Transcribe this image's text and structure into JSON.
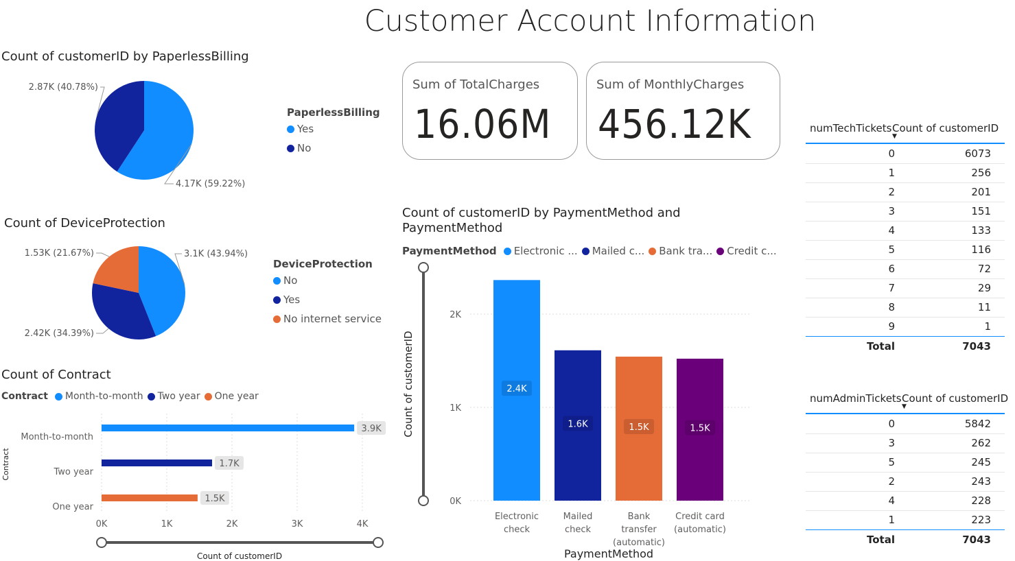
{
  "page": {
    "title": "Customer Account Information"
  },
  "colors": {
    "light_blue": "#118DFF",
    "dark_blue": "#12239E",
    "orange": "#E66C37",
    "purple": "#6B007B"
  },
  "cards": [
    {
      "label": "Sum of TotalCharges",
      "value": "16.06M"
    },
    {
      "label": "Sum of MonthlyCharges",
      "value": "456.12K"
    }
  ],
  "tables": {
    "tech": {
      "headers": [
        "numTechTickets",
        "Count of customerID"
      ],
      "rows": [
        [
          "0",
          "6073"
        ],
        [
          "1",
          "256"
        ],
        [
          "2",
          "201"
        ],
        [
          "3",
          "151"
        ],
        [
          "4",
          "133"
        ],
        [
          "5",
          "116"
        ],
        [
          "6",
          "72"
        ],
        [
          "7",
          "29"
        ],
        [
          "8",
          "11"
        ],
        [
          "9",
          "1"
        ]
      ],
      "total_label": "Total",
      "total_value": "7043"
    },
    "admin": {
      "headers": [
        "numAdminTickets",
        "Count of customerID"
      ],
      "rows": [
        [
          "0",
          "5842"
        ],
        [
          "3",
          "262"
        ],
        [
          "5",
          "245"
        ],
        [
          "2",
          "243"
        ],
        [
          "4",
          "228"
        ],
        [
          "1",
          "223"
        ]
      ],
      "total_label": "Total",
      "total_value": "7043"
    }
  },
  "chart_data": [
    {
      "type": "pie",
      "title": "Count of customerID by PaperlessBilling",
      "legend_title": "PaperlessBilling",
      "legend_position": "right",
      "slices": [
        {
          "label": "Yes",
          "value": 4170,
          "display": "4.17K (59.22%)",
          "color": "#118DFF"
        },
        {
          "label": "No",
          "value": 2870,
          "display": "2.87K (40.78%)",
          "color": "#12239E"
        }
      ]
    },
    {
      "type": "pie",
      "title": "Count of DeviceProtection",
      "legend_title": "DeviceProtection",
      "legend_position": "right",
      "slices": [
        {
          "label": "No",
          "value": 3100,
          "display": "3.1K (43.94%)",
          "color": "#118DFF"
        },
        {
          "label": "Yes",
          "value": 2420,
          "display": "2.42K (34.39%)",
          "color": "#12239E"
        },
        {
          "label": "No internet service",
          "value": 1530,
          "display": "1.53K (21.67%)",
          "color": "#E66C37"
        }
      ]
    },
    {
      "type": "bar",
      "orientation": "horizontal",
      "title": "Count of Contract",
      "legend_title": "Contract",
      "legend_position": "top-left",
      "categories": [
        "Month-to-month",
        "Two year",
        "One year"
      ],
      "values": [
        3875,
        1695,
        1473
      ],
      "data_labels": [
        "3.9K",
        "1.7K",
        "1.5K"
      ],
      "colors": [
        "#118DFF",
        "#12239E",
        "#E66C37"
      ],
      "xlabel": "Count of customerID",
      "ylabel": "Contract",
      "xlim": [
        0,
        4000
      ],
      "xticks": [
        "0K",
        "1K",
        "2K",
        "3K",
        "4K"
      ],
      "grid": true
    },
    {
      "type": "bar",
      "orientation": "vertical",
      "title": "Count of customerID by PaymentMethod and PaymentMethod",
      "legend_title": "PaymentMethod",
      "legend_position": "top-left",
      "legend_labels": [
        "Electronic ...",
        "Mailed c...",
        "Bank tra...",
        "Credit c..."
      ],
      "categories": [
        [
          "Electronic",
          "check"
        ],
        [
          "Mailed",
          "check"
        ],
        [
          "Bank",
          "transfer",
          "(automatic)"
        ],
        [
          "Credit card",
          "(automatic)"
        ]
      ],
      "values": [
        2365,
        1612,
        1544,
        1522
      ],
      "data_labels": [
        "2.4K",
        "1.6K",
        "1.5K",
        "1.5K"
      ],
      "colors": [
        "#118DFF",
        "#12239E",
        "#E66C37",
        "#6B007B"
      ],
      "xlabel": "PaymentMethod",
      "ylabel": "Count of customerID",
      "ylim": [
        0,
        2500
      ],
      "yticks": [
        "0K",
        "1K",
        "2K"
      ],
      "grid": true
    }
  ]
}
